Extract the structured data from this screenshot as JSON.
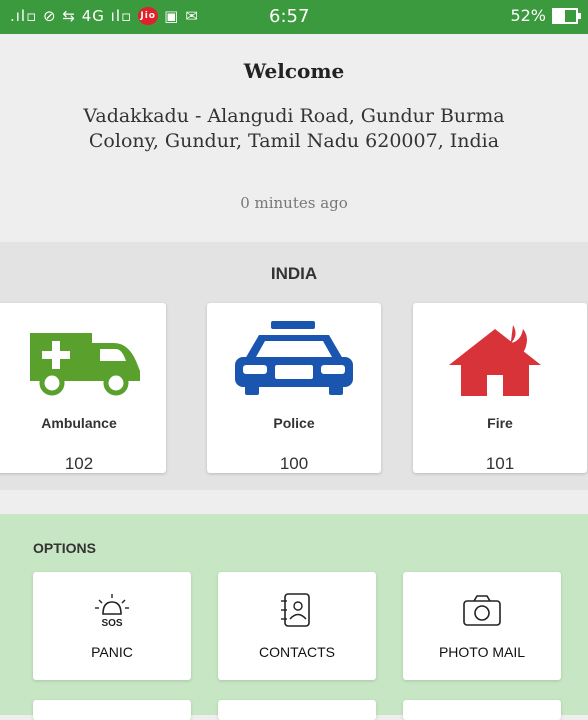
{
  "status_bar": {
    "left_icons": ".ıl▫ ⊘ ⇆ 4G ıl▫",
    "jio": "Jio",
    "time": "6:57",
    "battery": "52%",
    "battery_level": 0.52
  },
  "location": {
    "welcome": "Welcome",
    "address": "Vadakkadu - Alangudi Road, Gundur Burma Colony, Gundur, Tamil Nadu 620007, India",
    "updated": "0 minutes ago"
  },
  "country": "INDIA",
  "services": [
    {
      "name": "Ambulance",
      "number": "102",
      "icon": "ambulance-icon",
      "color": "#5aa02c"
    },
    {
      "name": "Police",
      "number": "100",
      "icon": "police-car-icon",
      "color": "#1a56b0"
    },
    {
      "name": "Fire",
      "number": "101",
      "icon": "fire-house-icon",
      "color": "#d9333a"
    }
  ],
  "options": {
    "title": "OPTIONS",
    "items": [
      {
        "label": "PANIC",
        "icon": "sos-siren-icon"
      },
      {
        "label": "CONTACTS",
        "icon": "contacts-book-icon"
      },
      {
        "label": "PHOTO MAIL",
        "icon": "camera-icon"
      }
    ]
  }
}
